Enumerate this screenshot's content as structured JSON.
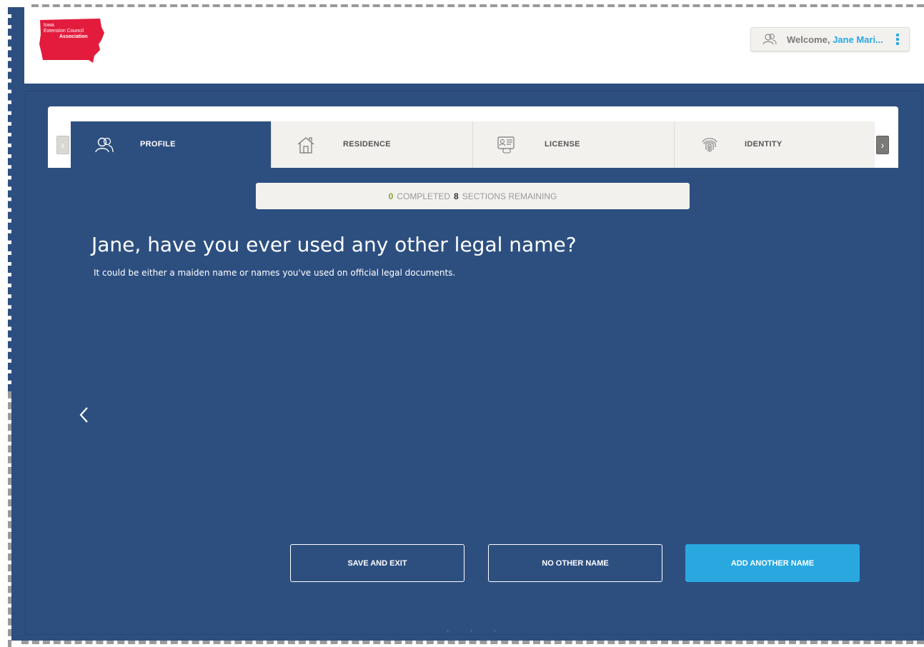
{
  "header": {
    "logo": {
      "line1": "Iowa",
      "line2": "Extension Council",
      "line3": "Association",
      "color": "#e31b3d"
    },
    "user_menu": {
      "welcome_prefix": "Welcome,",
      "user_name": "Jane Mari...",
      "icons": [
        "user-icon",
        "kebab-menu-icon"
      ]
    }
  },
  "tabs": [
    {
      "label": "PROFILE",
      "icon": "profile-icon",
      "active": true
    },
    {
      "label": "RESIDENCE",
      "icon": "house-icon",
      "active": false
    },
    {
      "label": "LICENSE",
      "icon": "license-icon",
      "active": false
    },
    {
      "label": "IDENTITY",
      "icon": "fingerprint-icon",
      "active": false
    }
  ],
  "progress": {
    "completed_count": "0",
    "completed_label": "COMPLETED",
    "remaining_count": "8",
    "remaining_label": "SECTIONS REMAINING"
  },
  "question": {
    "title": "Jane, have you ever used any other legal name?",
    "subtitle": "It could be either a maiden name or names you've used on official legal documents."
  },
  "actions": {
    "save_exit": "SAVE AND EXIT",
    "no_other": "NO OTHER NAME",
    "add_another": "ADD ANOTHER NAME"
  },
  "colors": {
    "panel": "#2d4f80",
    "accent": "#29a8e0",
    "completed": "#8aa036"
  }
}
